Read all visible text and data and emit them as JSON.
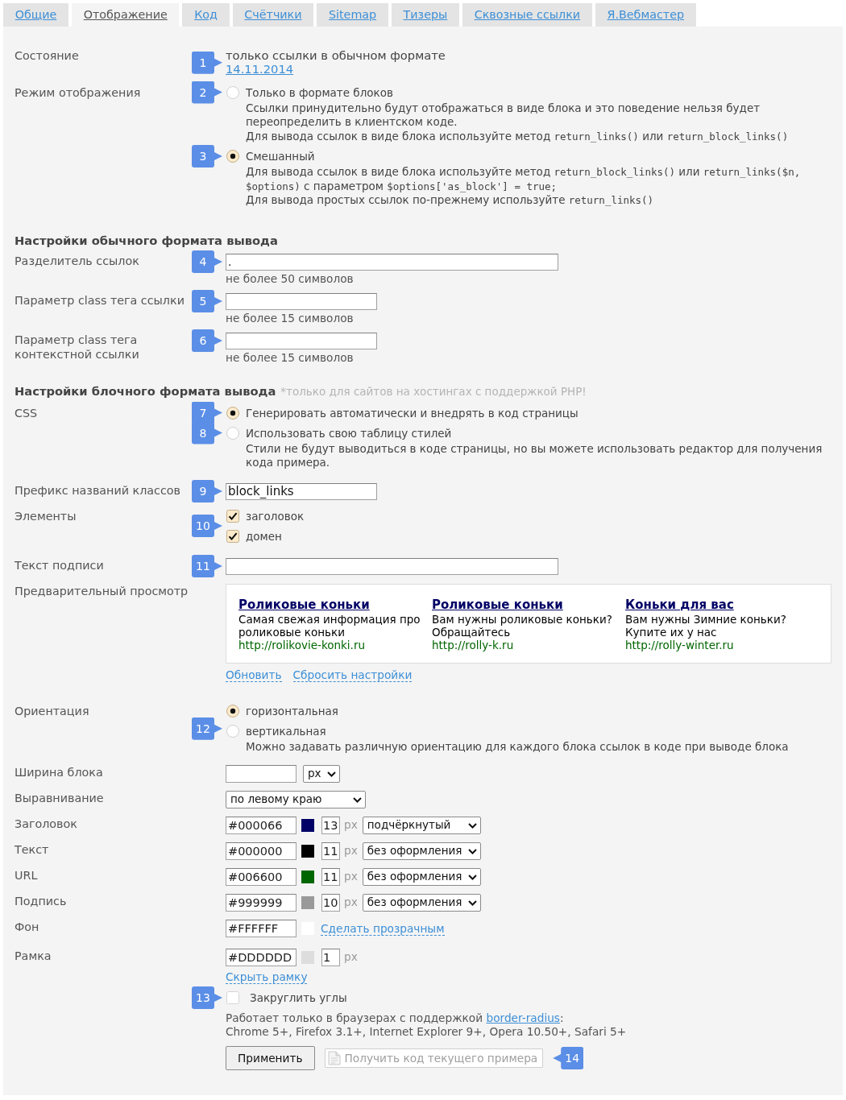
{
  "tabs": [
    {
      "label": "Общие",
      "selected": false
    },
    {
      "label": "Отображение",
      "selected": true
    },
    {
      "label": "Код",
      "selected": false
    },
    {
      "label": "Счётчики",
      "selected": false
    },
    {
      "label": "Sitemap",
      "selected": false
    },
    {
      "label": "Тизеры",
      "selected": false
    },
    {
      "label": "Сквозные ссылки",
      "selected": false
    },
    {
      "label": "Я.Вебмастер",
      "selected": false
    }
  ],
  "status": {
    "label": "Состояние",
    "callout": "1",
    "text": "только ссылки в обычном формате",
    "date": "14.11.2014"
  },
  "display_mode": {
    "label": "Режим отображения",
    "options": [
      {
        "callout": "2",
        "label": "Только в формате блоков",
        "selected": false,
        "notes": [
          [
            {
              "kind": "text",
              "text": "Ссылки принудительно будут отображаться в виде блока и это поведение нельзя будет переопределить в клиентском коде."
            }
          ],
          [
            {
              "kind": "text",
              "text": "Для вывода ссылок в виде блока используйте метод "
            },
            {
              "kind": "code",
              "text": "return_links()"
            },
            {
              "kind": "text",
              "text": " или "
            },
            {
              "kind": "code",
              "text": "return_block_links()"
            }
          ]
        ]
      },
      {
        "callout": "3",
        "label": "Смешанный",
        "selected": true,
        "notes": [
          [
            {
              "kind": "text",
              "text": "Для вывода ссылок в виде блока используйте метод "
            },
            {
              "kind": "code",
              "text": "return_block_links()"
            },
            {
              "kind": "text",
              "text": " или "
            },
            {
              "kind": "code",
              "text": "return_links($n, $options)"
            },
            {
              "kind": "text",
              "text": " с параметром "
            },
            {
              "kind": "code",
              "text": "$options['as_block'] = true;"
            }
          ],
          [
            {
              "kind": "text",
              "text": "Для вывода простых ссылок по-прежнему используйте "
            },
            {
              "kind": "code",
              "text": "return_links()"
            }
          ]
        ]
      }
    ]
  },
  "plain_format": {
    "title": "Настройки обычного формата вывода",
    "fields": [
      {
        "kind": "long",
        "label": "Разделитель ссылок",
        "callout": "4",
        "value": ".",
        "hint": "не более 50 символов"
      },
      {
        "kind": "short",
        "label": "Параметр class тега ссылки",
        "callout": "5",
        "hint": "не более 15 символов"
      },
      {
        "kind": "short",
        "label": "Параметр class тега контекстной ссылки",
        "callout": "6",
        "hint": "не более 15 символов"
      }
    ]
  },
  "block_format": {
    "title": "Настройки блочного формата вывода",
    "note": "*только для сайтов на хостингах с поддержкой PHP!",
    "css": {
      "label": "CSS",
      "options": [
        {
          "callout": "7",
          "label": "Генерировать автоматически и внедрять в код страницы",
          "selected": true
        },
        {
          "callout": "8",
          "label": "Использовать свою таблицу стилей",
          "selected": false,
          "notes": [
            [
              {
                "kind": "text",
                "text": "Стили не будут выводиться в коде страницы, но вы можете использовать редактор для получения кода примера."
              }
            ]
          ]
        }
      ]
    },
    "class_prefix": {
      "label": "Префикс названий классов",
      "callout": "9",
      "value": "block_links"
    },
    "elements": {
      "label": "Элементы",
      "callout": "10",
      "options": [
        {
          "label": "заголовок",
          "checked": true
        },
        {
          "label": "домен",
          "checked": true
        }
      ]
    },
    "caption": {
      "label": "Текст подписи",
      "callout": "11"
    },
    "preview": {
      "label": "Предварительный просмотр",
      "blocks": [
        {
          "title": "Роликовые коньки",
          "text": "Самая свежая информация про роликовые коньки",
          "url": "http://rolikovie-konki.ru"
        },
        {
          "title": "Роликовые коньки",
          "text": "Вам нужны роликовые коньки? Обращайтесь",
          "url": "http://rolly-k.ru"
        },
        {
          "title": "Коньки для вас",
          "text": "Вам нужны Зимние коньки? Купите их у нас",
          "url": "http://rolly-winter.ru"
        }
      ],
      "links": [
        "Обновить",
        "Сбросить настройки"
      ]
    },
    "orientation": {
      "label": "Ориентация",
      "callout": "12",
      "options": [
        {
          "label": "горизонтальная",
          "selected": true
        },
        {
          "label": "вертикальная",
          "selected": false,
          "notes": [
            [
              {
                "kind": "text",
                "text": "Можно задавать различную ориентацию для каждого блока ссылок в коде при выводе блока"
              }
            ]
          ]
        }
      ]
    },
    "style_rows": [
      {
        "kind": "width",
        "label": "Ширина блока",
        "select": "px"
      },
      {
        "kind": "align",
        "label": "Выравнивание",
        "select": "по левому краю"
      },
      {
        "kind": "font",
        "label": "Заголовок",
        "value": "#000066",
        "color": "#000066",
        "size": "13",
        "unit": "px",
        "select": "подчёркнутый"
      },
      {
        "kind": "font",
        "label": "Текст",
        "value": "#000000",
        "color": "#000000",
        "size": "11",
        "unit": "px",
        "select": "без оформления"
      },
      {
        "kind": "font",
        "label": "URL",
        "value": "#006600",
        "color": "#006600",
        "size": "11",
        "unit": "px",
        "select": "без оформления"
      },
      {
        "kind": "font",
        "label": "Подпись",
        "value": "#999999",
        "color": "#999999",
        "size": "10",
        "unit": "px",
        "select": "без оформления"
      },
      {
        "kind": "background",
        "label": "Фон",
        "value": "#FFFFFF",
        "color": "#ffffff",
        "link": "Сделать прозрачным"
      },
      {
        "kind": "border",
        "label": "Рамка",
        "value": "#DDDDDD",
        "color": "#dddddd",
        "size": "1",
        "unit": "px",
        "link": "Скрыть рамку"
      }
    ],
    "rounded_corners": {
      "callout": "13",
      "label": "Закруглить углы",
      "checked": false,
      "note": [
        {
          "kind": "text",
          "text": "Работает только в браузерах с поддержкой "
        },
        {
          "kind": "link",
          "text": "border-radius"
        },
        {
          "kind": "text",
          "text": ":"
        }
      ],
      "browsers": "Chrome 5+, Firefox 3.1+, Internet Explorer 9+, Opera 10.50+, Safari 5+"
    },
    "buttons": [
      {
        "kind": "submit",
        "label": "Применить",
        "disabled": false
      },
      {
        "kind": "export",
        "label": "Получить код текущего примера",
        "disabled": true,
        "callout": "14"
      }
    ]
  }
}
